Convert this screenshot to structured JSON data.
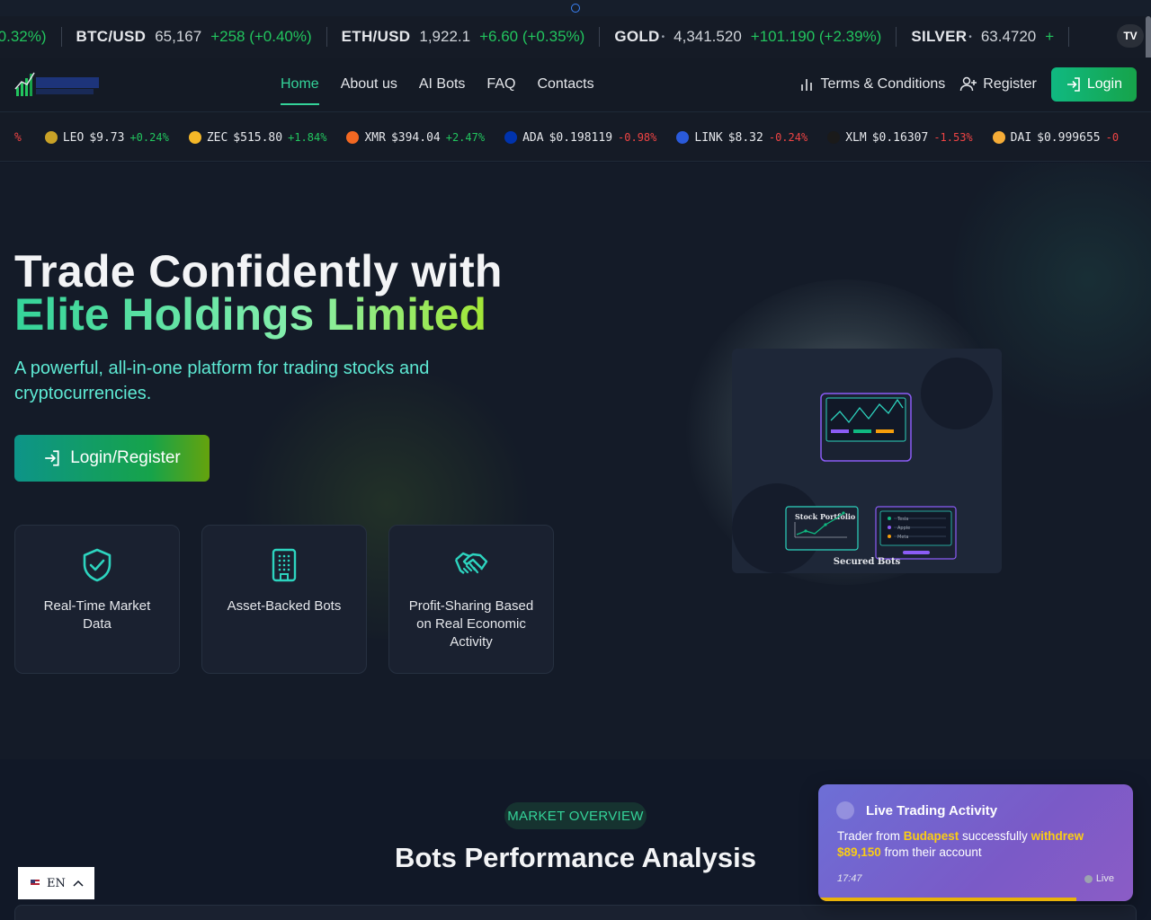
{
  "ticker_top": {
    "lead_change": "-0.32%)",
    "items": [
      {
        "symbol": "BTC/USD",
        "dot": "",
        "price": "65,167",
        "change": "+258 (+0.40%)"
      },
      {
        "symbol": "ETH/USD",
        "dot": "",
        "price": "1,922.1",
        "change": "+6.60 (+0.35%)"
      },
      {
        "symbol": "GOLD",
        "dot": "•",
        "price": "4,341.520",
        "change": "+101.190 (+2.39%)"
      },
      {
        "symbol": "SILVER",
        "dot": "•",
        "price": "63.4720",
        "change": "+"
      }
    ],
    "badge": "TV"
  },
  "nav": {
    "links": [
      {
        "label": "Home",
        "active": true
      },
      {
        "label": "About us",
        "active": false
      },
      {
        "label": "AI Bots",
        "active": false
      },
      {
        "label": "FAQ",
        "active": false
      },
      {
        "label": "Contacts",
        "active": false
      }
    ],
    "terms": "Terms & Conditions",
    "register": "Register",
    "login": "Login",
    "logo_text": "ELITE HOLDINGS LTD",
    "logo_tagline": "Investment Management & Advisory"
  },
  "ticker_coins": {
    "lead": "%",
    "items": [
      {
        "symbol": "LEO",
        "price": "$9.73",
        "change": "+0.24%",
        "dir": "pos",
        "color": "#c9a227"
      },
      {
        "symbol": "ZEC",
        "price": "$515.80",
        "change": "+1.84%",
        "dir": "pos",
        "color": "#f4b728"
      },
      {
        "symbol": "XMR",
        "price": "$394.04",
        "change": "+2.47%",
        "dir": "pos",
        "color": "#f26822"
      },
      {
        "symbol": "ADA",
        "price": "$0.198119",
        "change": "-0.98%",
        "dir": "neg",
        "color": "#0033ad"
      },
      {
        "symbol": "LINK",
        "price": "$8.32",
        "change": "-0.24%",
        "dir": "neg",
        "color": "#2a5ada"
      },
      {
        "symbol": "XLM",
        "price": "$0.16307",
        "change": "-1.53%",
        "dir": "neg",
        "color": "#1a1a1a"
      },
      {
        "symbol": "DAI",
        "price": "$0.999655",
        "change": "-0",
        "dir": "neg",
        "color": "#f5ac37"
      }
    ]
  },
  "hero": {
    "title_line1": "Trade Confidently with",
    "title_line2": "Elite Holdings Limited",
    "subtitle": "A powerful, all-in-one platform for trading stocks and cryptocurrencies.",
    "cta": "Login/Register",
    "features": [
      {
        "label": "Real-Time Market Data",
        "icon": "shield-check-icon"
      },
      {
        "label": "Asset-Backed Bots",
        "icon": "building-icon"
      },
      {
        "label": "Profit-Sharing Based on Real Economic Activity",
        "icon": "handshake-icon"
      }
    ],
    "illustration": {
      "card_label": "Stock Portfolio",
      "caption": "Secured Bots",
      "list": [
        "Tesla",
        "Apple",
        "Meta"
      ]
    }
  },
  "section": {
    "pill": "MARKET OVERVIEW",
    "title": "Bots Performance Analysis"
  },
  "lang": {
    "code": "EN"
  },
  "toast": {
    "title": "Live Trading Activity",
    "text_before": "Trader from ",
    "city": "Budapest",
    "text_mid": " successfully ",
    "action": "withdrew",
    "amount": "$89,150",
    "text_after": " from their account",
    "time": "17:47",
    "status": "Live",
    "progress_fraction": 0.82
  },
  "colors": {
    "accent": "#34d399",
    "positive": "#22c55e",
    "negative": "#ef4444",
    "highlight": "#facc15"
  }
}
